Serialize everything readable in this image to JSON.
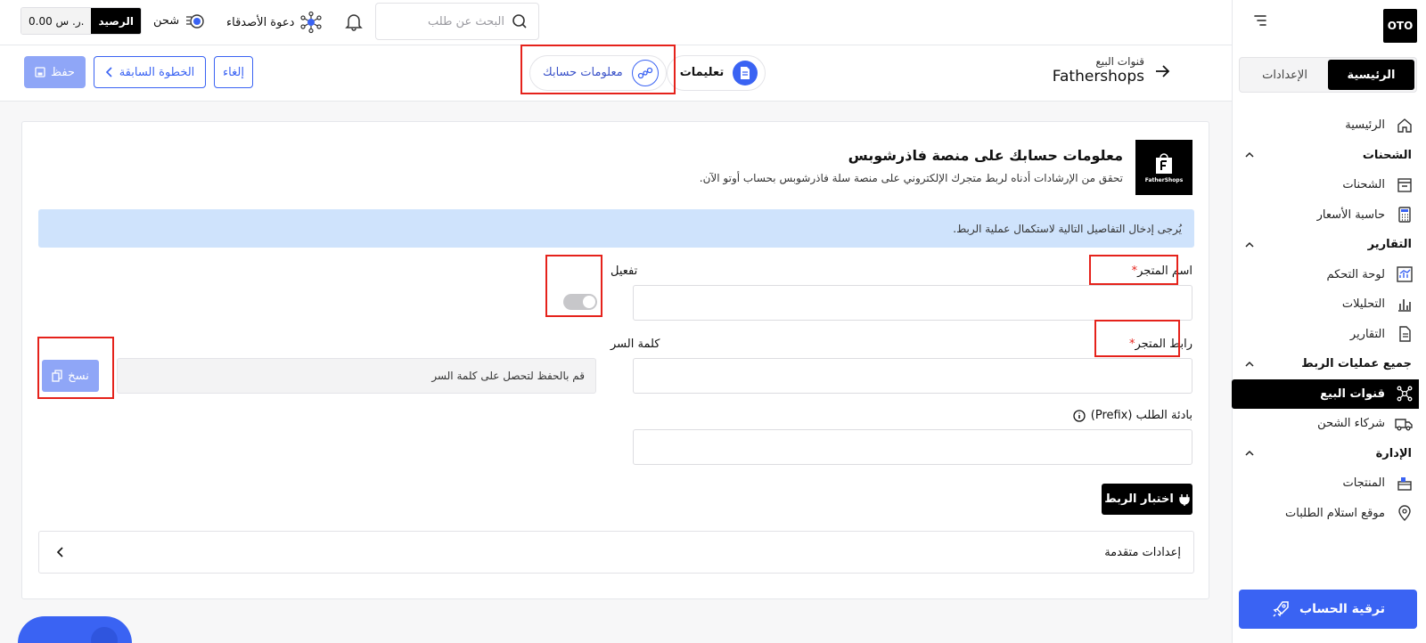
{
  "sidebar": {
    "logo": "OTO",
    "tabs": {
      "home": "الرئيسية",
      "settings": "الإعدادات"
    },
    "home_item": "الرئيسية",
    "sections": [
      {
        "title": "الشحنات",
        "items": [
          "الشحنات",
          "حاسبة الأسعار"
        ]
      },
      {
        "title": "التقارير",
        "items": [
          "لوحة التحكم",
          "التحليلات",
          "التقارير"
        ]
      },
      {
        "title": "جميع عمليات الربط",
        "items": [
          "قنوات البيع",
          "شركاء الشحن"
        ]
      },
      {
        "title": "الإدارة",
        "items": [
          "المنتجات",
          "موقع استلام الطلبات"
        ]
      }
    ],
    "upgrade_label": "ترقية الحساب"
  },
  "topbar": {
    "search_placeholder": "البحث عن طلب",
    "invite_label": "دعوة الأصدقاء",
    "recharge_label": "شحن",
    "balance_label": "الرصيد",
    "balance_value": "0.00 ر. س."
  },
  "subbar": {
    "back_small": "قنوات البيع",
    "back_big": "Fathershops",
    "step_instructions": "تعليمات",
    "step_account": "معلومات حسابك",
    "cancel_label": "إلغاء",
    "prev_label": "الخطوة السابقة",
    "save_label": "حفظ"
  },
  "card": {
    "brand_name": "FatherShops",
    "title": "معلومات حسابك على منصة فاذرشوبس",
    "subtitle": "تحقق من الإرشادات أدناه لربط متجرك الإلكتروني على منصة سلة فاذرشوبس بحساب أوتو الآن.",
    "info": "يُرجى إدخال التفاصيل التالية لاستكمال عملية الربط.",
    "store_name_label": "اسم المتجر",
    "activate_label": "تفعيل",
    "store_url_label": "رابط المتجر",
    "password_label": "كلمة السر",
    "password_placeholder": "قم بالحفظ لتحصل على كلمة السر",
    "copy_label": "نسخ",
    "prefix_label": "بادئة الطلب (Prefix)",
    "test_label": "اختبار الربط",
    "advanced_label": "إعدادات متقدمة",
    "required_mark": "*"
  },
  "colors": {
    "primary": "#3a63f3",
    "highlight": "#e5221b",
    "info_bg": "#cfe3fc"
  }
}
